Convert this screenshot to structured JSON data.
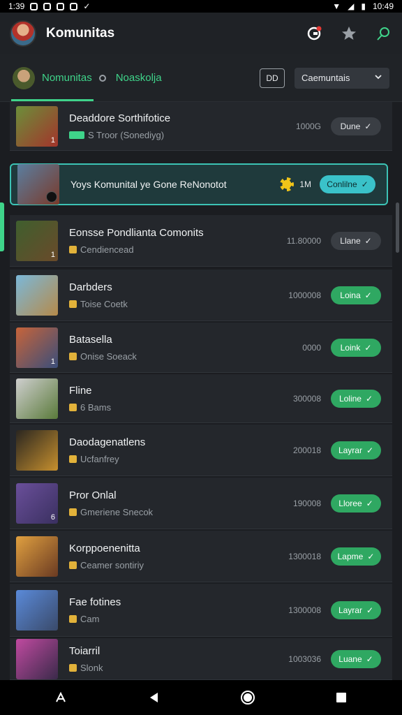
{
  "status": {
    "time_left": "1:39",
    "time_right": "10:49"
  },
  "app": {
    "title": "Komunitas"
  },
  "tabs": {
    "tab1": "Nomunitas",
    "tab2": "Noaskolja",
    "toggle_label": "DD",
    "dropdown": "Caemuntais"
  },
  "items": [
    {
      "name": "Deaddore Sorthifotice",
      "sub": "S Troor (Sonediyg)",
      "count": "1000G",
      "button": "Dune",
      "btn": "grey",
      "num": "1",
      "thumb": [
        "#6b8f3a",
        "#a3342b"
      ]
    },
    {
      "name": "Yoys Komunital ye Gone ReNonotot",
      "sub": "",
      "count": "1M",
      "button": "Conlilne",
      "btn": "teal",
      "num": "",
      "thumb": [
        "#5a7ea0",
        "#7a3a2a"
      ],
      "highlight": true
    },
    {
      "name": "Eonsse Pondlianta Comonits",
      "sub": "Cendiencead",
      "count": "11.80000",
      "button": "Llane",
      "btn": "grey",
      "num": "1",
      "thumb": [
        "#3f5f2e",
        "#6a4a2a"
      ]
    },
    {
      "name": "Darbders",
      "sub": "Toise Coetk",
      "count": "1000008",
      "button": "Loina",
      "btn": "green",
      "num": "",
      "thumb": [
        "#7bb8d9",
        "#b58a4a"
      ]
    },
    {
      "name": "Batasella",
      "sub": "Onise Soeack",
      "count": "0000",
      "button": "Loink",
      "btn": "green",
      "num": "1",
      "thumb": [
        "#c7643a",
        "#3a4e7a"
      ]
    },
    {
      "name": "Fline",
      "sub": "6 Bams",
      "count": "300008",
      "button": "Loline",
      "btn": "green",
      "num": "",
      "thumb": [
        "#cfcfcf",
        "#5a7a3a"
      ]
    },
    {
      "name": "Daodagenatlens",
      "sub": "Ucfanfrey",
      "count": "200018",
      "button": "Layrar",
      "btn": "green",
      "num": "",
      "thumb": [
        "#2a2620",
        "#c7902e"
      ]
    },
    {
      "name": "Pror Onlal",
      "sub": "Gmeriene Snecok",
      "count": "190008",
      "button": "Lloree",
      "btn": "green",
      "num": "6",
      "thumb": [
        "#6a4f9a",
        "#3a3060"
      ]
    },
    {
      "name": "Korppoenenitta",
      "sub": "Ceamer sontiriy",
      "count": "1300018",
      "button": "Lapme",
      "btn": "green",
      "num": "",
      "thumb": [
        "#e0a040",
        "#6a3a22"
      ]
    },
    {
      "name": "Fae fotines",
      "sub": "Cam",
      "count": "1300008",
      "button": "Layrar",
      "btn": "green",
      "num": "",
      "thumb": [
        "#5a8ad9",
        "#3a4a6a"
      ]
    },
    {
      "name": "Toiarril",
      "sub": "Slonk",
      "count": "1003036",
      "button": "Luane",
      "btn": "green",
      "num": "",
      "thumb": [
        "#c04aa0",
        "#3a2a4a"
      ]
    }
  ],
  "icons": {
    "avatar": "profile-avatar",
    "action1": "notification-icon",
    "action2": "star-icon",
    "action3": "search-icon"
  },
  "colors": {
    "accent": "#3fd48a",
    "highlight_border": "#3cc3b5",
    "join_green": "#2fa862"
  }
}
